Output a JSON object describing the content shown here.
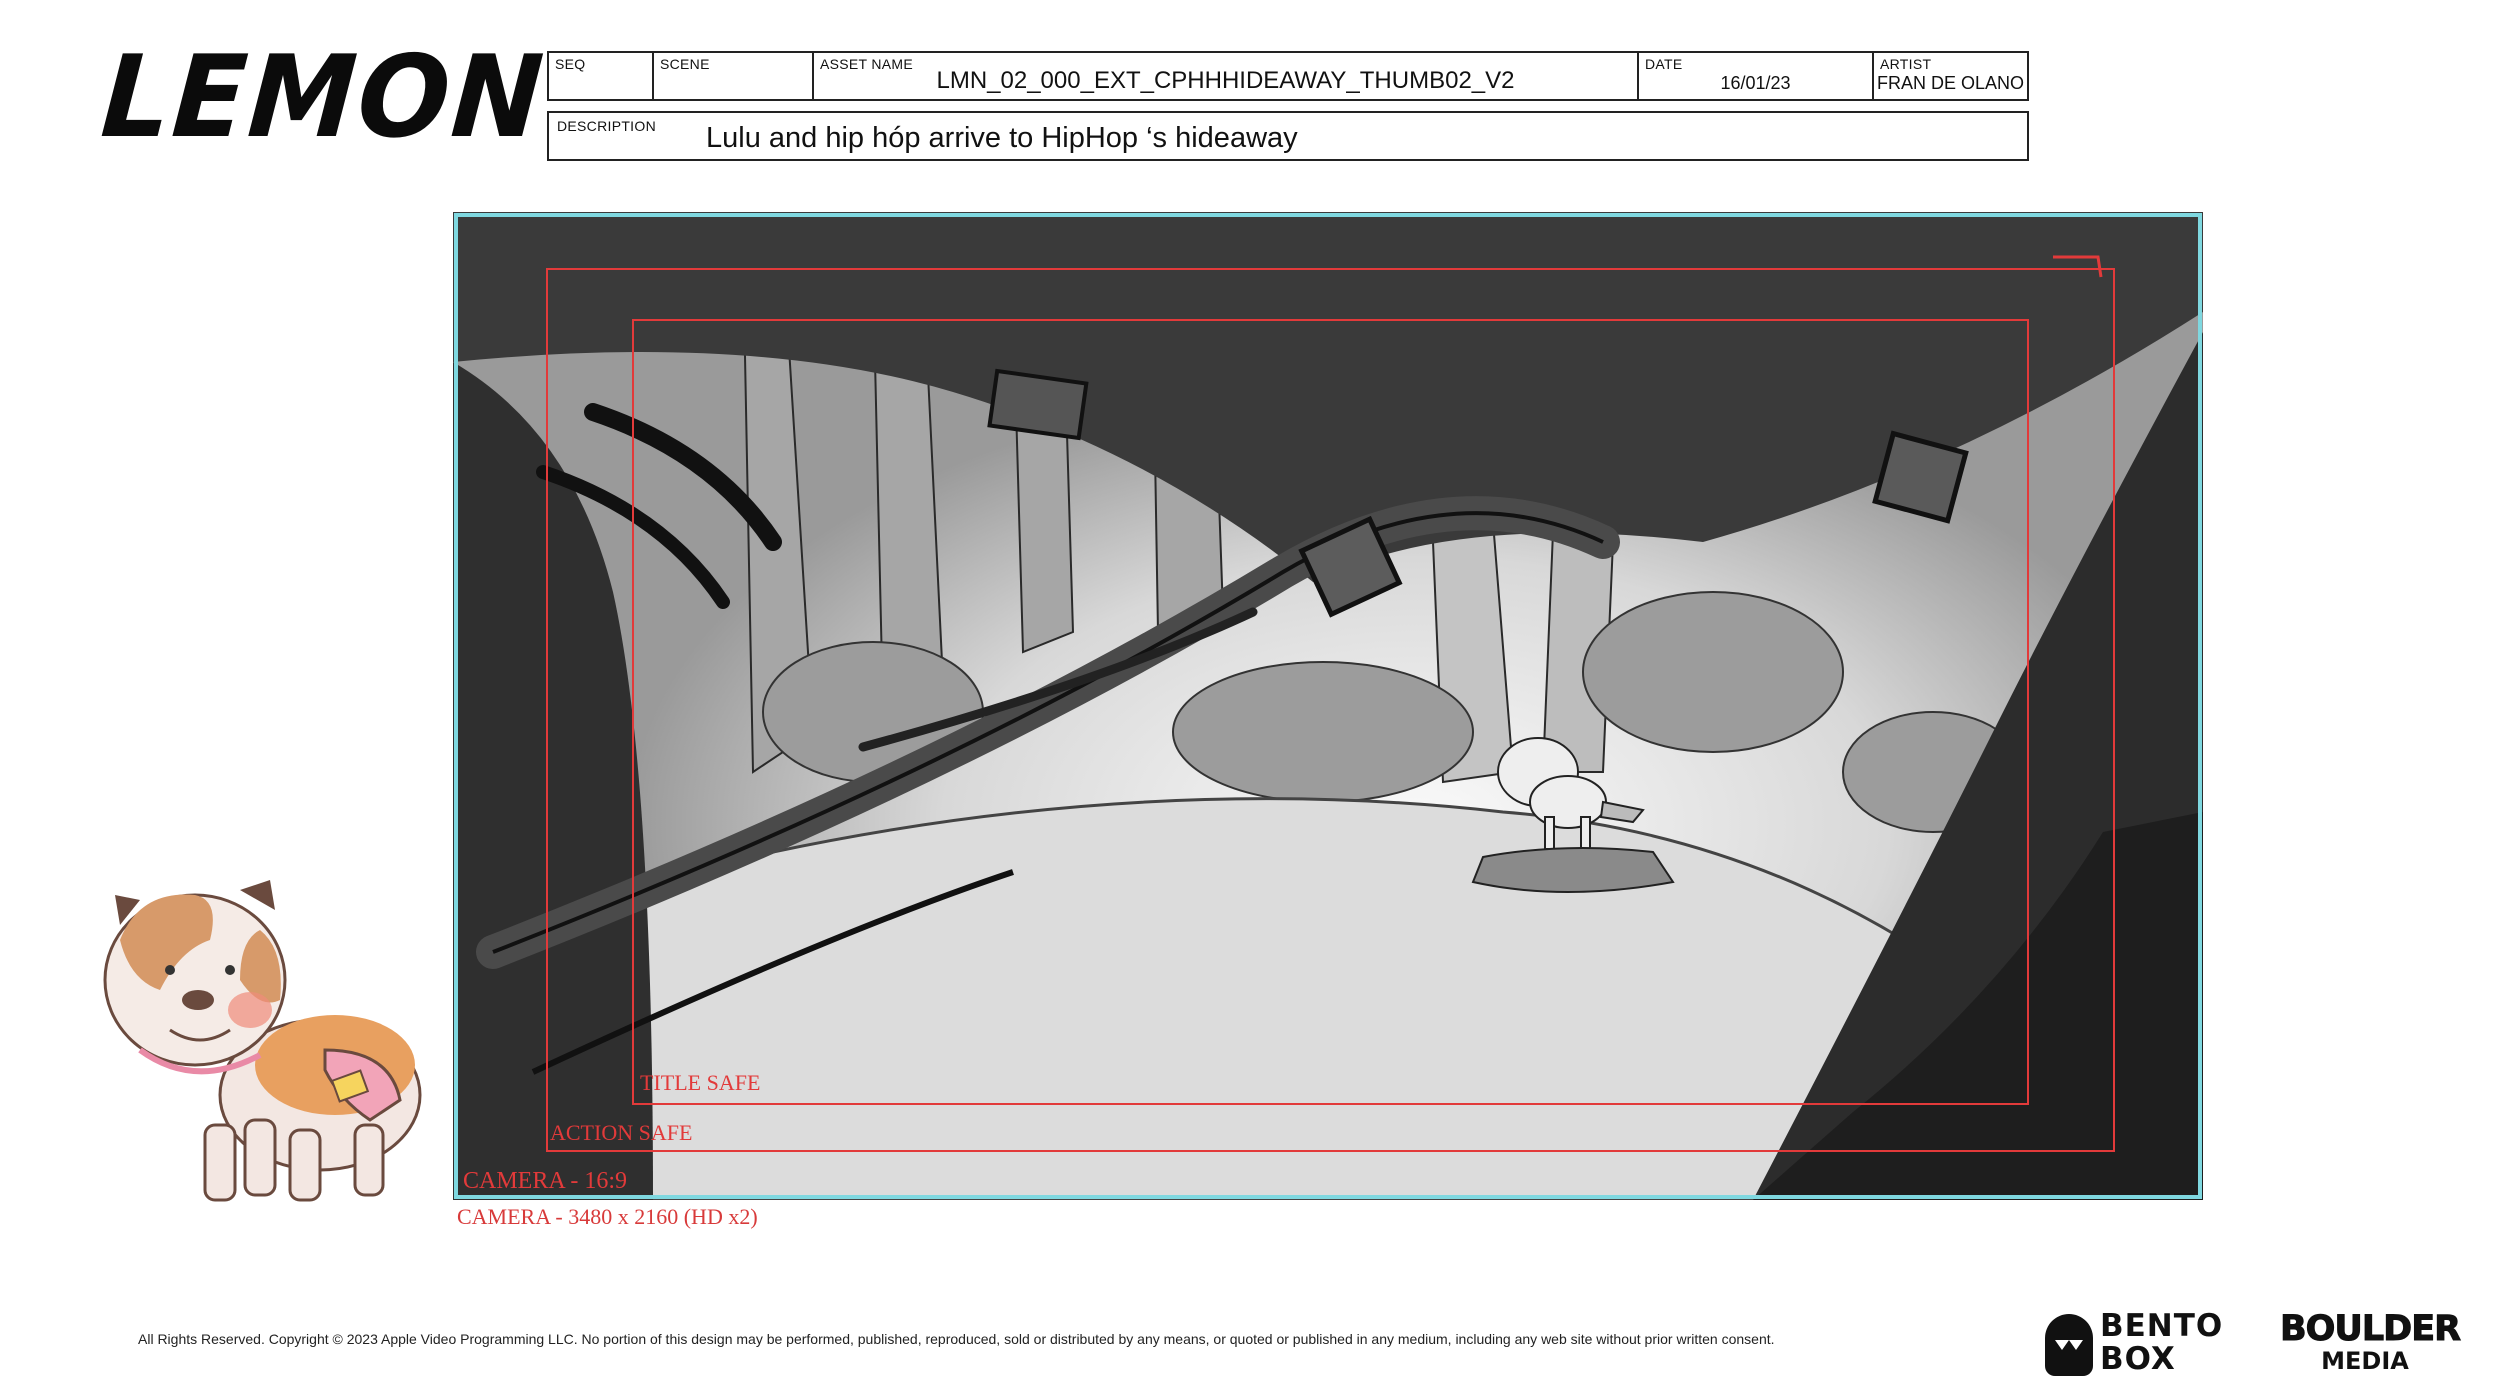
{
  "logo": {
    "text": "LEMON"
  },
  "header": {
    "seq": {
      "label": "SEQ",
      "value": ""
    },
    "scene": {
      "label": "SCENE",
      "value": ""
    },
    "asset_name": {
      "label": "ASSET NAME",
      "value": "LMN_02_000_EXT_CPHHHIDEAWAY_THUMB02_V2"
    },
    "date": {
      "label": "DATE",
      "value": "16/01/23"
    },
    "artist": {
      "label": "ARTIST",
      "value": "FRAN DE OLANO"
    }
  },
  "description": {
    "label": "DESCRIPTION",
    "text": "Lulu and hip hóp arrive to HipHop ‘s hideaway"
  },
  "guides": {
    "title_safe": "TITLE SAFE",
    "action_safe": "ACTION SAFE",
    "camera": "CAMERA - 16:9",
    "camera_resolution": "CAMERA - 3480 x 2160 (HD x2)",
    "colors": {
      "camera_frame": "#7fd8e0",
      "safe_lines": "#e23a3a"
    }
  },
  "footer": {
    "copyright": "All Rights Reserved. Copyright © 2023 Apple Video Programming LLC. No portion of this design may be performed, published, reproduced, sold or distributed by any means, or quoted or published in any medium, including any web site without prior written consent.",
    "bento_line1": "BENTO",
    "bento_line2": "BOX",
    "boulder_line1": "BOULDER",
    "boulder_line2": "MEDIA"
  },
  "character": {
    "icon": "bulldog-character"
  }
}
